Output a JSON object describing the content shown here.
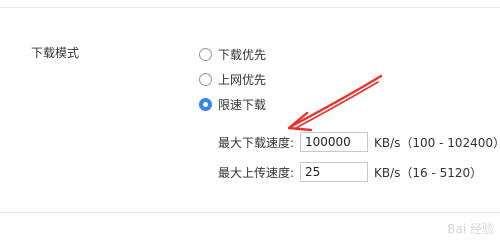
{
  "download_mode": {
    "label": "下载模式",
    "options": [
      {
        "label": "下载优先",
        "checked": false
      },
      {
        "label": "上网优先",
        "checked": false
      },
      {
        "label": "限速下载",
        "checked": true
      }
    ]
  },
  "speed_limits": {
    "max_download": {
      "label": "最大下载速度:",
      "value": "100000",
      "unit": "KB/s（100 - 102400）"
    },
    "max_upload": {
      "label": "最大上传速度:",
      "value": "25",
      "unit": "KB/s（16 - 5120）"
    }
  },
  "annotation": {
    "arrow_color": "#e8322d"
  },
  "colors": {
    "accent": "#3b82f6"
  },
  "watermark": {
    "text": "Bai 经验"
  }
}
